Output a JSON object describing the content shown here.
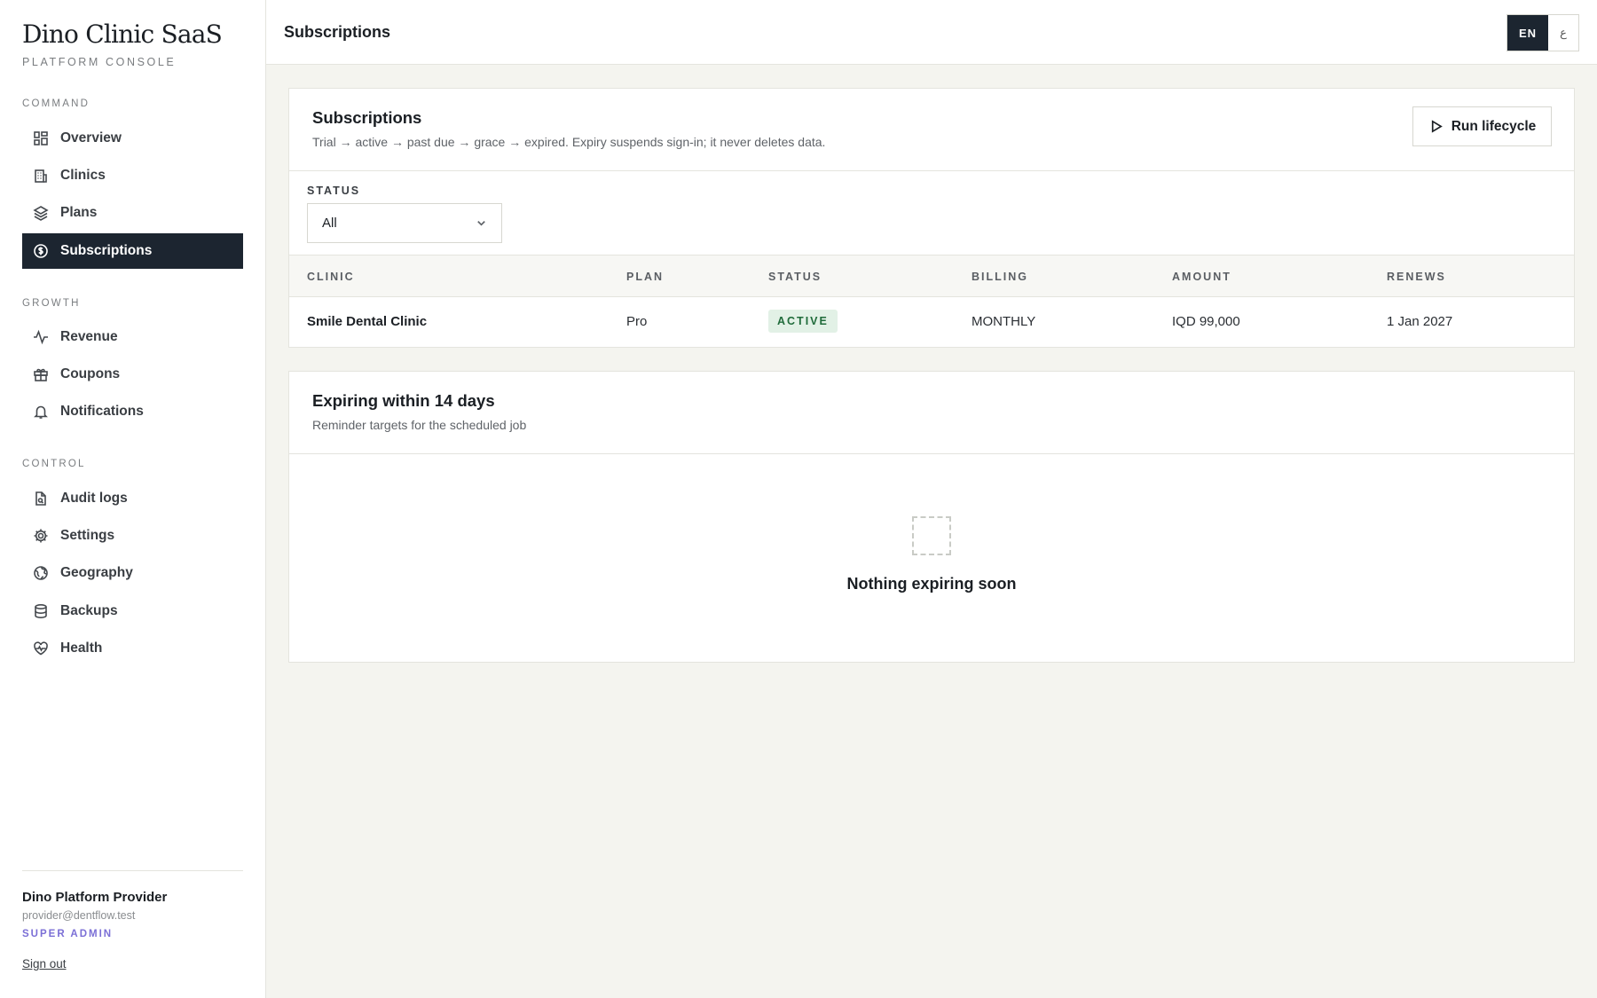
{
  "brand": {
    "title": "Dino Clinic SaaS",
    "subtitle": "PLATFORM CONSOLE"
  },
  "sidebar": {
    "sections": [
      {
        "label": "COMMAND"
      },
      {
        "label": "GROWTH"
      },
      {
        "label": "CONTROL"
      }
    ],
    "items": [
      {
        "label": "Overview",
        "icon": "grid-icon"
      },
      {
        "label": "Clinics",
        "icon": "building-icon"
      },
      {
        "label": "Plans",
        "icon": "layers-icon"
      },
      {
        "label": "Subscriptions",
        "icon": "dollar-circle-icon",
        "active": true
      },
      {
        "label": "Revenue",
        "icon": "activity-icon"
      },
      {
        "label": "Coupons",
        "icon": "gift-icon"
      },
      {
        "label": "Notifications",
        "icon": "bell-icon"
      },
      {
        "label": "Audit logs",
        "icon": "file-search-icon"
      },
      {
        "label": "Settings",
        "icon": "gear-icon"
      },
      {
        "label": "Geography",
        "icon": "globe-icon"
      },
      {
        "label": "Backups",
        "icon": "database-icon"
      },
      {
        "label": "Health",
        "icon": "heart-pulse-icon"
      }
    ],
    "user": {
      "name": "Dino Platform Provider",
      "email": "provider@dentflow.test",
      "role": "SUPER ADMIN",
      "signout": "Sign out"
    }
  },
  "topbar": {
    "title": "Subscriptions",
    "lang": {
      "en": "EN",
      "ar": "ع",
      "active": "EN"
    }
  },
  "subscriptions_card": {
    "title": "Subscriptions",
    "description": "Trial → active → past due → grace → expired. Expiry suspends sign-in; it never deletes data.",
    "run_button": "Run lifecycle",
    "filter": {
      "label": "STATUS",
      "value": "All"
    },
    "columns": [
      "CLINIC",
      "PLAN",
      "STATUS",
      "BILLING",
      "AMOUNT",
      "RENEWS"
    ],
    "rows": [
      {
        "clinic": "Smile Dental Clinic",
        "plan": "Pro",
        "status": "ACTIVE",
        "billing": "MONTHLY",
        "amount": "IQD 99,000",
        "renews": "1 Jan 2027"
      }
    ]
  },
  "expiring_card": {
    "title": "Expiring within 14 days",
    "description": "Reminder targets for the scheduled job",
    "empty_text": "Nothing expiring soon"
  },
  "colors": {
    "accent_dark": "#1c2530",
    "background": "#f4f4ef",
    "badge_bg": "#e2f1e6",
    "badge_text": "#1f6b3a",
    "role_text": "#7b6fd6"
  }
}
